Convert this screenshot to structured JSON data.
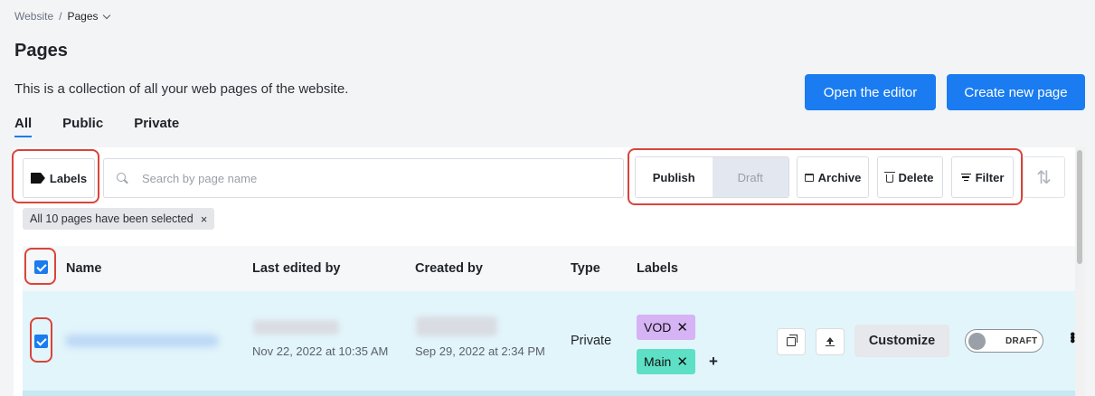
{
  "breadcrumb": {
    "root": "Website",
    "separator": "/",
    "current": "Pages"
  },
  "page": {
    "title": "Pages",
    "description": "This is a collection of all your web pages of the website."
  },
  "actions": {
    "open_editor": "Open the editor",
    "create_page": "Create new page"
  },
  "tabs": [
    {
      "label": "All",
      "active": true
    },
    {
      "label": "Public",
      "active": false
    },
    {
      "label": "Private",
      "active": false
    }
  ],
  "toolbar": {
    "labels_button": "Labels",
    "search_placeholder": "Search by page name",
    "publish": "Publish",
    "draft": "Draft",
    "archive": "Archive",
    "delete": "Delete",
    "filter": "Filter"
  },
  "selection": {
    "text": "All 10 pages have been selected",
    "close": "×"
  },
  "table": {
    "columns": [
      "Name",
      "Last edited by",
      "Created by",
      "Type",
      "Labels"
    ],
    "rows": [
      {
        "checked": true,
        "last_edited_date": "Nov 22, 2022 at 10:35 AM",
        "created_date": "Sep 29, 2022 at 2:34 PM",
        "type": "Private",
        "labels": [
          {
            "text": "VOD",
            "color": "#d6b3f5"
          },
          {
            "text": "Main",
            "color": "#5ee0c6"
          }
        ],
        "add_label": "+",
        "customize": "Customize",
        "status_toggle": "DRAFT"
      }
    ]
  },
  "colors": {
    "accent": "#1a7cf0",
    "highlight": "#d9443a",
    "row_selected": "#e2f5fb"
  }
}
